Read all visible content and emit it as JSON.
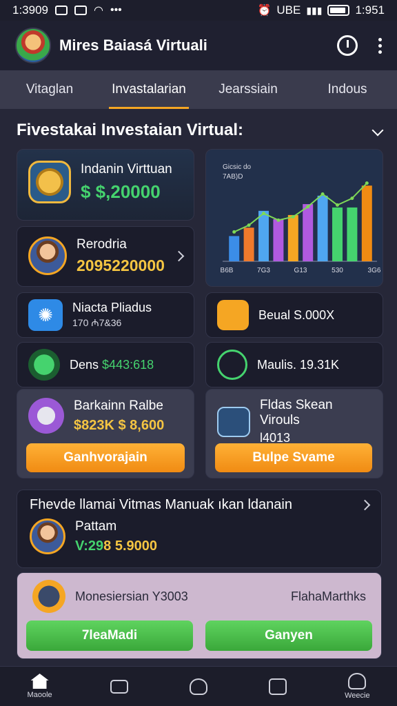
{
  "status_bar": {
    "time_left": "1:3909",
    "time_right": "1:951",
    "network": "UBE"
  },
  "header": {
    "title": "Mires Baiasá Virtuali"
  },
  "tabs": [
    {
      "label": "Vitaglan"
    },
    {
      "label": "Invastalarian"
    },
    {
      "label": "Jearssiain"
    },
    {
      "label": "Indous"
    }
  ],
  "section": {
    "title": "Fivestakai Investaian Virtual:"
  },
  "balance": {
    "label": "Indanin Virttuan",
    "value": "$ $,20000"
  },
  "profile": {
    "label": "Rerodria",
    "value": "2095220000"
  },
  "chart_data": {
    "type": "bar",
    "title": "",
    "legend_lines": [
      "Gicsic do",
      "7AB)D"
    ],
    "categories": [
      "B6B",
      "7G3",
      "G13",
      "530",
      "3G6"
    ],
    "series": [
      {
        "values": [
          30,
          40,
          60,
          50,
          55,
          68,
          78,
          64,
          64,
          90
        ]
      }
    ],
    "bar_colors": [
      "#3b8de8",
      "#f07a2c",
      "#4fa6f0",
      "#b05ae0",
      "#f5a623",
      "#b05ae0",
      "#4fa6f0",
      "#45d36e",
      "#45d36e",
      "#f08b13"
    ],
    "trend_line": [
      30,
      38,
      52,
      44,
      48,
      60,
      75,
      62,
      70,
      88
    ],
    "trend_color": "#7ed957",
    "ylim": [
      0,
      100
    ]
  },
  "mini_cards": {
    "settings": {
      "label": "Niacta Pliadus",
      "value": "170 ₼7&36"
    },
    "bean": {
      "label": "Beual S.000X"
    },
    "dens": {
      "label": "Dens",
      "value": "$443:618"
    },
    "mauls": {
      "label": "Maulis. 19.31K"
    }
  },
  "offer_left": {
    "label": "Barkainn Ralbe",
    "value": "$823K $ 8,600",
    "button": "Ganhvorajain"
  },
  "offer_right": {
    "label": "Fldas Skean Virouls",
    "value": "l4013",
    "button": "Bulpe Svame"
  },
  "promo": {
    "title": "Fhevde llamai Vitmas Manuak ıkan ldanain",
    "subtitle": "Pattam",
    "value_prefix": "V:29",
    "value": "8 5.9000"
  },
  "action_bar": {
    "left_label": "Monesiersian Y3003",
    "right_label": "FlahaMarthks",
    "btn_left": "7leaMadi",
    "btn_right": "Ganyen"
  },
  "bottom_nav": {
    "home": "Maoole",
    "profile": "Weecie"
  },
  "colors": {
    "accent": "#f5a623",
    "green": "#45d36e",
    "bg": "#262738"
  }
}
